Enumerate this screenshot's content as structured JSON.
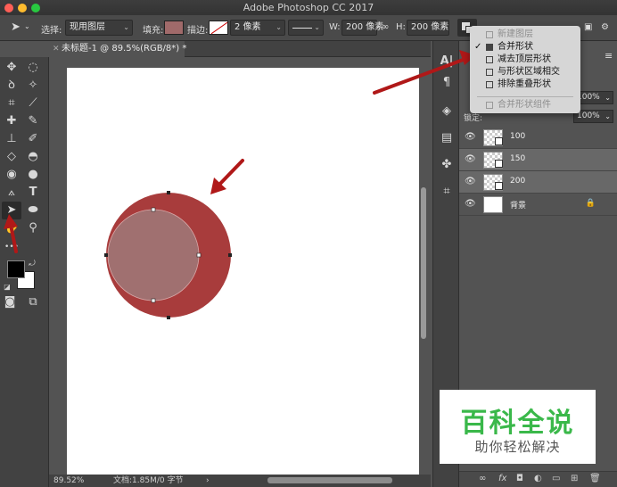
{
  "app_title": "Adobe Photoshop CC 2017",
  "options_bar": {
    "select_label": "选择:",
    "select_value": "现用图层",
    "fill_label": "填充:",
    "fill_color": "#a06a6a",
    "stroke_label": "描边:",
    "stroke_size": "2 像素",
    "w_label": "W:",
    "w_value": "200 像素",
    "h_label": "H:",
    "h_value": "200 像素"
  },
  "document": {
    "tab_title": "未标题-1 @ 89.5%(RGB/8*) *",
    "zoom": "89.52%",
    "doc_info": "文档:1.85M/0 字节"
  },
  "shape_operation_menu": {
    "items": [
      {
        "label": "新建图层",
        "enabled": false,
        "checked": false
      },
      {
        "label": "合并形状",
        "enabled": true,
        "checked": true
      },
      {
        "label": "减去顶层形状",
        "enabled": true,
        "checked": false
      },
      {
        "label": "与形状区域相交",
        "enabled": true,
        "checked": false
      },
      {
        "label": "排除重叠形状",
        "enabled": true,
        "checked": false
      },
      {
        "label": "合并形状组件",
        "enabled": false,
        "checked": false
      }
    ]
  },
  "layers_panel": {
    "opacity_value": "100%",
    "fill_value": "100%",
    "lock_label": "锁定:",
    "layers": [
      {
        "name": "100",
        "selected": false
      },
      {
        "name": "150",
        "selected": true
      },
      {
        "name": "200",
        "selected": true
      },
      {
        "name": "背景",
        "selected": false
      }
    ]
  },
  "watermark": {
    "title": "百科全说",
    "subtitle": "助你轻松解决"
  },
  "colors": {
    "outer_circle": "#a83c3c",
    "inner_circle": "#a07070",
    "arrow_red": "#b01818",
    "watermark_green": "#3ab84a"
  }
}
